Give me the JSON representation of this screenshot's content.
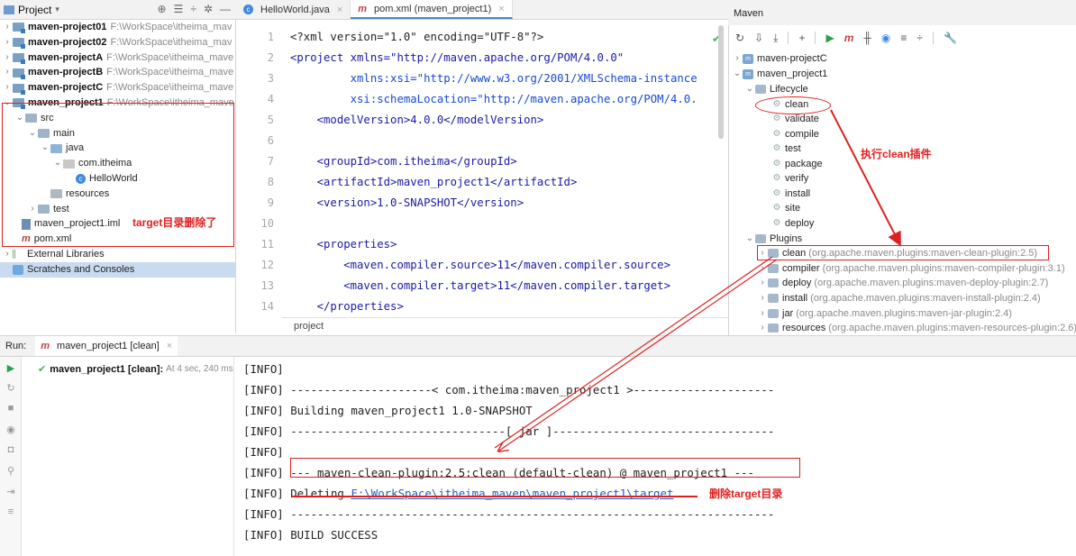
{
  "project_panel": {
    "title": "Project",
    "header_tools": [
      "⊕",
      "☰",
      "÷",
      "✲",
      "—"
    ],
    "tree": [
      {
        "label": "maven-project01",
        "path": "F:\\WorkSpace\\itheima_mav",
        "kind": "module"
      },
      {
        "label": "maven-project02",
        "path": "F:\\WorkSpace\\itheima_mav",
        "kind": "module"
      },
      {
        "label": "maven-projectA",
        "path": "F:\\WorkSpace\\itheima_mave",
        "kind": "module"
      },
      {
        "label": "maven-projectB",
        "path": "F:\\WorkSpace\\itheima_mave",
        "kind": "module"
      },
      {
        "label": "maven-projectC",
        "path": "F:\\WorkSpace\\itheima_mave",
        "kind": "module"
      },
      {
        "label": "maven_project1",
        "path": "F:\\WorkSpace\\itheima_mave",
        "kind": "module"
      },
      {
        "label": "src"
      },
      {
        "label": "main"
      },
      {
        "label": "java"
      },
      {
        "label": "com.itheima"
      },
      {
        "label": "HelloWorld"
      },
      {
        "label": "resources"
      },
      {
        "label": "test"
      },
      {
        "label": "maven_project1.iml"
      },
      {
        "label": "pom.xml"
      },
      {
        "label": "External Libraries"
      },
      {
        "label": "Scratches and Consoles"
      }
    ],
    "annotation": "target目录删除了"
  },
  "editor": {
    "tabs": [
      {
        "label": "HelloWorld.java",
        "active": false
      },
      {
        "label": "pom.xml (maven_project1)",
        "active": true
      }
    ],
    "line_numbers": [
      "1",
      "2",
      "3",
      "4",
      "5",
      "6",
      "7",
      "8",
      "9",
      "10",
      "11",
      "12",
      "13",
      "14"
    ],
    "lines": {
      "l1": "<?xml version=\"1.0\" encoding=\"UTF-8\"?>",
      "l2": "<project xmlns=\"http://maven.apache.org/POM/4.0.0\"",
      "l3": "         xmlns:xsi=\"http://www.w3.org/2001/XMLSchema-instance",
      "l4": "         xsi:schemaLocation=\"http://maven.apache.org/POM/4.0.",
      "l5": "    <modelVersion>4.0.0</modelVersion>",
      "l6": "",
      "l7": "    <groupId>com.itheima</groupId>",
      "l8": "    <artifactId>maven_project1</artifactId>",
      "l9": "    <version>1.0-SNAPSHOT</version>",
      "l10": "",
      "l11": "    <properties>",
      "l12": "        <maven.compiler.source>11</maven.compiler.source>",
      "l13": "        <maven.compiler.target>11</maven.compiler.target>",
      "l14": "    </properties>"
    },
    "breadcrumb": "project"
  },
  "maven_panel": {
    "title": "Maven",
    "toolbar": [
      "↻",
      "⇩",
      "⤓",
      "+",
      "▶",
      "m",
      "╫",
      "◉",
      "≡",
      "÷",
      "🔧"
    ],
    "items": {
      "projectC": "maven-projectC",
      "project1": "maven_project1",
      "lifecycle": "Lifecycle",
      "phases": [
        "clean",
        "validate",
        "compile",
        "test",
        "package",
        "verify",
        "install",
        "site",
        "deploy"
      ],
      "plugins": "Plugins",
      "plugin_list": [
        {
          "name": "clean",
          "coord": "(org.apache.maven.plugins:maven-clean-plugin:2.5)"
        },
        {
          "name": "compiler",
          "coord": "(org.apache.maven.plugins:maven-compiler-plugin:3.1)"
        },
        {
          "name": "deploy",
          "coord": "(org.apache.maven.plugins:maven-deploy-plugin:2.7)"
        },
        {
          "name": "install",
          "coord": "(org.apache.maven.plugins:maven-install-plugin:2.4)"
        },
        {
          "name": "jar",
          "coord": "(org.apache.maven.plugins:maven-jar-plugin:2.4)"
        },
        {
          "name": "resources",
          "coord": "(org.apache.maven.plugins:maven-resources-plugin:2.6)"
        }
      ]
    },
    "annotation": "执行clean插件"
  },
  "run_panel": {
    "label": "Run:",
    "tab": "maven_project1 [clean]",
    "tree_item": "maven_project1 [clean]:",
    "tree_time": "At 4 sec, 240 ms",
    "console": {
      "c1": "[INFO]",
      "c2": "[INFO] ---------------------< com.itheima:maven_project1 >---------------------",
      "c3": "[INFO] Building maven_project1 1.0-SNAPSHOT",
      "c4": "[INFO] --------------------------------[ jar ]---------------------------------",
      "c5": "[INFO]",
      "c6": "[INFO] --- maven-clean-plugin:2.5:clean (default-clean) @ maven_project1 ---",
      "c7_prefix": "[INFO] Deleting ",
      "c7_link": "F:\\WorkSpace\\itheima_maven\\maven_project1\\target",
      "c8": "[INFO] ------------------------------------------------------------------------",
      "c9": "[INFO] BUILD SUCCESS"
    },
    "annotation": "删除target目录"
  },
  "colors": {
    "annotation": "#e02020",
    "link": "#1f5fbf",
    "success": "#4caf50"
  }
}
